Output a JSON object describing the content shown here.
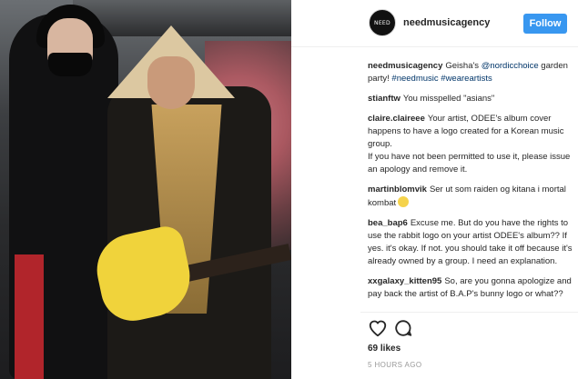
{
  "post": {
    "username": "needmusicagency",
    "avatar_text": "NEED",
    "follow_label": "Follow",
    "likes": "69 likes",
    "timestamp": "5 HOURS AGO"
  },
  "comments": [
    {
      "user": "needmusicagency",
      "parts": [
        {
          "text": "Geisha's ",
          "kind": "plain"
        },
        {
          "text": "@nordicchoice",
          "kind": "tag"
        },
        {
          "text": " garden party! ",
          "kind": "plain"
        },
        {
          "text": "#needmusic",
          "kind": "tag"
        },
        {
          "text": " ",
          "kind": "plain"
        },
        {
          "text": "#weareartists",
          "kind": "tag"
        }
      ]
    },
    {
      "user": "stianftw",
      "parts": [
        {
          "text": "You misspelled \"asians\"",
          "kind": "plain"
        }
      ]
    },
    {
      "user": "claire.claireee",
      "parts": [
        {
          "text": "Your artist, ODEE's album cover happens to have a logo created for a Korean music group.\nIf you have not been permitted to use it, please issue an apology and remove it.",
          "kind": "plain"
        }
      ]
    },
    {
      "user": "martinblomvik",
      "parts": [
        {
          "text": "Ser ut som raiden og kitana i mortal kombat",
          "kind": "plain"
        }
      ],
      "emoji": "grinning-face-emoji"
    },
    {
      "user": "bea_bap6",
      "parts": [
        {
          "text": "Excuse me. But do you have the rights to use the rabbit logo on your artist ODEE's album?? If yes. it's okay. If not. you should take it off because it's already owned by a group. I need an explanation.",
          "kind": "plain"
        }
      ]
    },
    {
      "user": "xxgalaxy_kitten95",
      "parts": [
        {
          "text": "So, are you gonna apologize and pay back the artist of B.A.P's bunny logo or what??",
          "kind": "plain"
        }
      ]
    }
  ],
  "icons": {
    "like": "heart-icon",
    "comment": "comment-bubble-icon"
  },
  "colors": {
    "follow_button": "#3897f0",
    "link": "#003569",
    "text": "#262626",
    "muted": "#999999"
  }
}
